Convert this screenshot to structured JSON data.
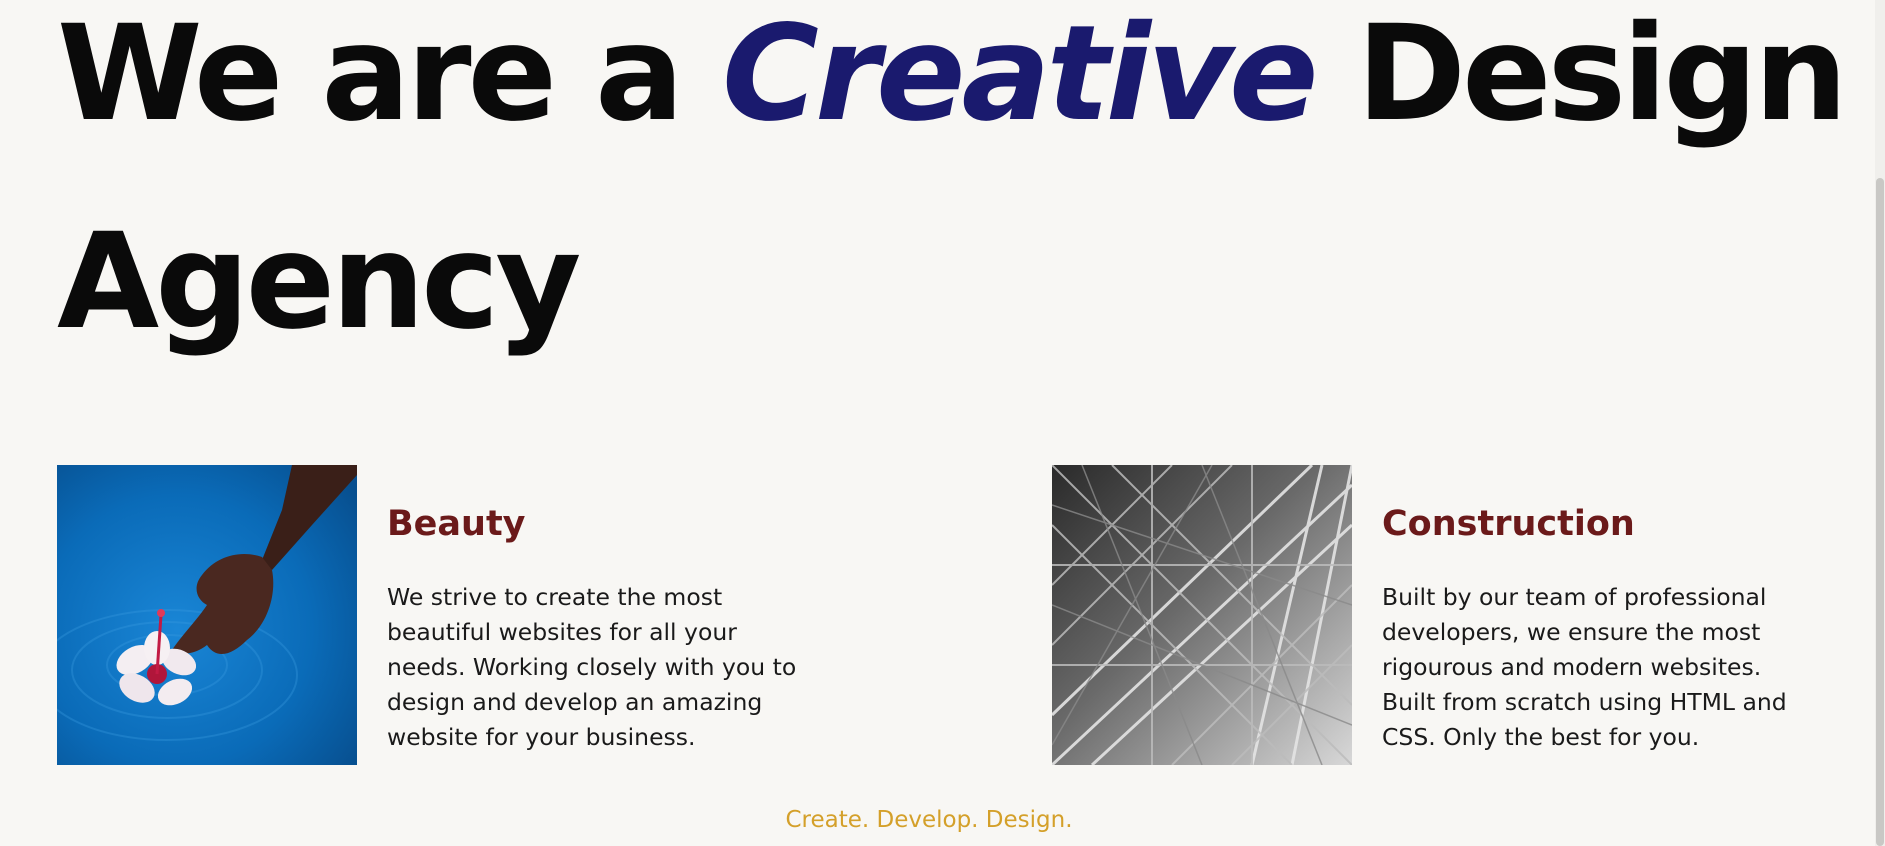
{
  "hero": {
    "part1": "We are a ",
    "accent": "Creative",
    "part2": " Design Agency"
  },
  "cards": [
    {
      "title": "Beauty",
      "text": "We strive to create the most beautiful websites for all your needs. Working closely with you to design and develop an amazing website for your business.",
      "image": "hand-and-flower-in-water"
    },
    {
      "title": "Construction",
      "text": "Built by our team of professional developers, we ensure the most rigourous and modern websites. Built from scratch using HTML and CSS. Only the best for you.",
      "image": "steel-structure-monochrome"
    }
  ],
  "footer": {
    "tagline": "Create. Develop. Design."
  },
  "colors": {
    "accent": "#1a1a6e",
    "card_title": "#6b1a1a",
    "tagline": "#d4a02a",
    "background": "#f8f7f4"
  }
}
